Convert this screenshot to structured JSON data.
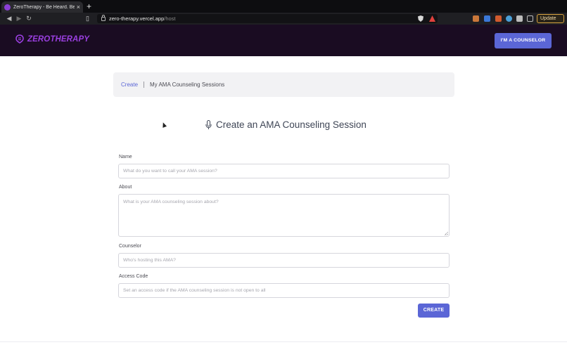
{
  "browser": {
    "tab_title": "ZeroTherapy - Be Heard. Be An",
    "tab_close": "×",
    "new_tab": "+",
    "url_host": "zero-therapy.vercel.app",
    "url_path": "/host",
    "update_label": "Update",
    "icons": [
      "back-icon",
      "forward-icon",
      "reload-icon",
      "bookmark-icon",
      "lock-icon",
      "brave-shield-icon",
      "brave-rewards-icon"
    ]
  },
  "header": {
    "logo_text": "ZEROTHERAPY",
    "counselor_button": "I'M A COUNSELOR",
    "brand_color": "#9a3fe0"
  },
  "breadcrumb": {
    "link": "Create",
    "current": "My AMA Counseling Sessions"
  },
  "page": {
    "heading": "Create an AMA Counseling Session"
  },
  "form": {
    "name_label": "Name",
    "name_placeholder": "What do you want to call your AMA session?",
    "about_label": "About",
    "about_placeholder": "What is your AMA counseling session about?",
    "counselor_label": "Counselor",
    "counselor_placeholder": "Who's hosting this AMA?",
    "access_label": "Access Code",
    "access_placeholder": "Set an access code if the AMA counseling session is not open to all",
    "submit": "CREATE"
  },
  "colors": {
    "accent": "#5b66d6",
    "header_bg": "#1a0c22"
  }
}
